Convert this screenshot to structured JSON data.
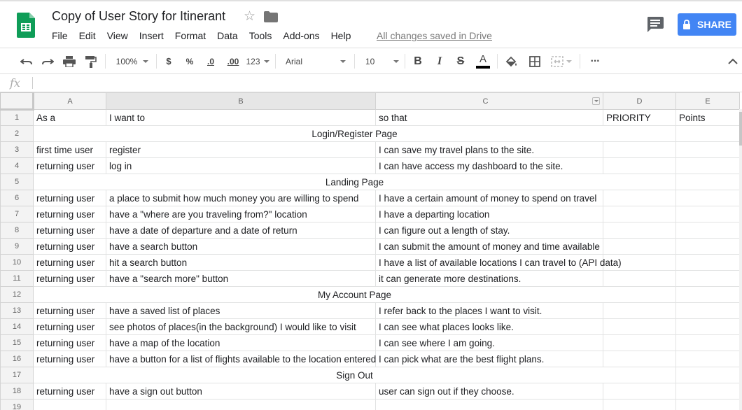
{
  "doc": {
    "title": "Copy of User Story for Itinerant",
    "save_status": "All changes saved in Drive"
  },
  "menu": [
    "File",
    "Edit",
    "View",
    "Insert",
    "Format",
    "Data",
    "Tools",
    "Add-ons",
    "Help"
  ],
  "share": {
    "label": "SHARE"
  },
  "toolbar": {
    "zoom": "100%",
    "currency": "$",
    "percent": "%",
    "decrease_decimals": ".0",
    "increase_decimals": ".00",
    "more_formats": "123",
    "font": "Arial",
    "font_size": "10",
    "bold": "B",
    "italic": "I",
    "strikethrough": "S",
    "text_color_letter": "A",
    "more": "···"
  },
  "formula_bar": {
    "fx": "fx",
    "value": ""
  },
  "colors": {
    "accent": "#4285f4",
    "sheets_green": "#0f9d58",
    "grid_line": "#e2e3e3",
    "header_bg": "#f3f3f3"
  },
  "sheet": {
    "columns": [
      "A",
      "B",
      "C",
      "D",
      "E"
    ],
    "rows": [
      {
        "n": "1",
        "cells": [
          "As a",
          "I want to",
          "so that",
          "PRIORITY",
          "Points"
        ]
      },
      {
        "n": "2",
        "section": "Login/Register Page"
      },
      {
        "n": "3",
        "cells": [
          "first time user",
          "register",
          "I can save my travel plans to the site.",
          "",
          ""
        ]
      },
      {
        "n": "4",
        "cells": [
          "returning user",
          "log in",
          "I can have access my dashboard to the site.",
          "",
          ""
        ]
      },
      {
        "n": "5",
        "section": "Landing Page"
      },
      {
        "n": "6",
        "cells": [
          "returning user",
          "a place to submit how much money you are willing to spend",
          "I have a certain amount of money to spend on travel",
          "",
          ""
        ]
      },
      {
        "n": "7",
        "cells": [
          "returning user",
          "have a \"where are you traveling from?\" location",
          "I have a departing location",
          "",
          ""
        ]
      },
      {
        "n": "8",
        "cells": [
          "returning user",
          "have a date of departure and a date of return",
          "I can figure out a length of stay.",
          "",
          ""
        ]
      },
      {
        "n": "9",
        "cells": [
          "returning user",
          "have a search button",
          "I can submit the amount of money and time available",
          "",
          ""
        ]
      },
      {
        "n": "10",
        "cells": [
          "returning user",
          "hit a search button",
          "I have a list of available locations I can travel to (API data)",
          "",
          ""
        ]
      },
      {
        "n": "11",
        "cells": [
          "returning user",
          "have a \"search more\" button",
          "it can generate more destinations.",
          "",
          ""
        ]
      },
      {
        "n": "12",
        "section": "My Account Page"
      },
      {
        "n": "13",
        "cells": [
          "returning user",
          "have a saved list of places",
          "I refer back to the places I want to visit.",
          "",
          ""
        ]
      },
      {
        "n": "14",
        "cells": [
          "returning user",
          "see photos of places(in the background) I would like to visit",
          "I can see what places looks like.",
          "",
          ""
        ]
      },
      {
        "n": "15",
        "cells": [
          "returning user",
          "have a map of the location",
          "I can see where I am going.",
          "",
          ""
        ]
      },
      {
        "n": "16",
        "cells": [
          "returning user",
          "have a button for a list of flights available to the location entered",
          "I can pick what are the best flight plans.",
          "",
          ""
        ]
      },
      {
        "n": "17",
        "section": "Sign Out"
      },
      {
        "n": "18",
        "cells": [
          "returning user",
          "have a sign out button",
          "user can sign out if they choose.",
          "",
          ""
        ]
      },
      {
        "n": "19",
        "cells": [
          "",
          "",
          "",
          "",
          ""
        ]
      }
    ]
  }
}
